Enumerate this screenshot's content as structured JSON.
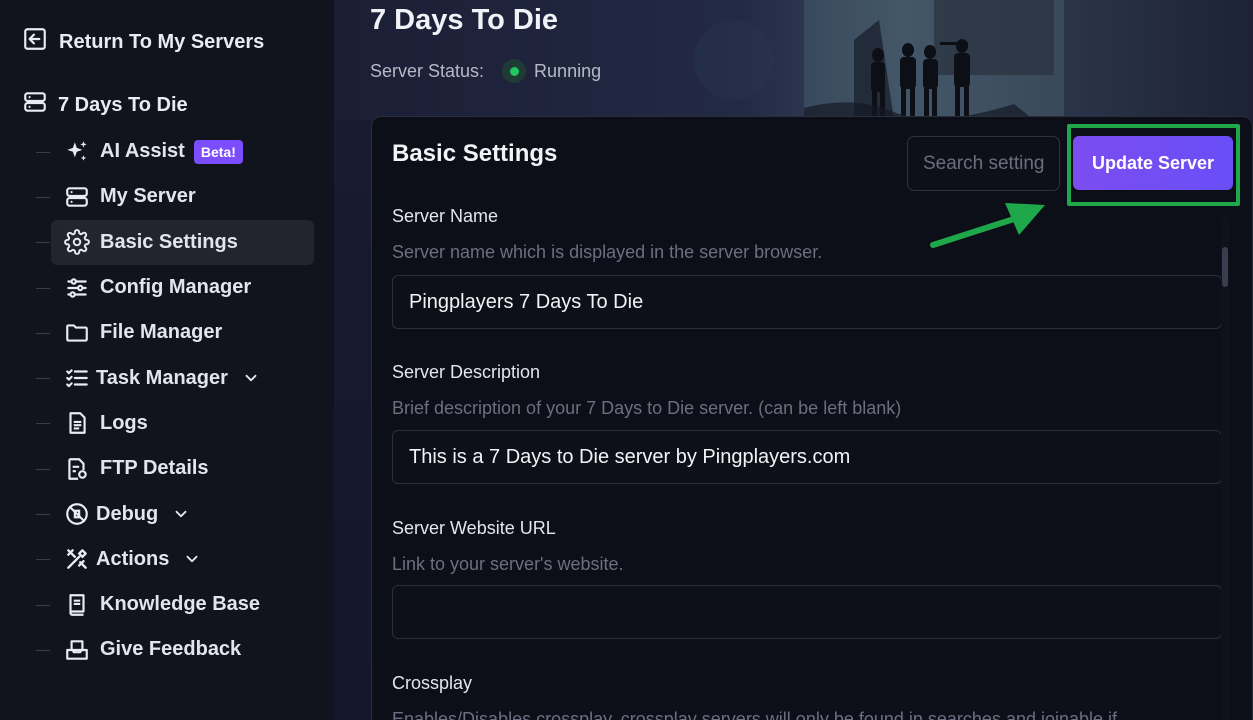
{
  "sidebar": {
    "return_label": "Return To My Servers",
    "server_name": "7 Days To Die",
    "items": [
      {
        "label": "AI Assist",
        "icon": "sparkles-icon",
        "badge": "Beta!"
      },
      {
        "label": "My Server",
        "icon": "server-icon"
      },
      {
        "label": "Basic Settings",
        "icon": "gear-icon",
        "active": true
      },
      {
        "label": "Config Manager",
        "icon": "sliders-icon"
      },
      {
        "label": "File Manager",
        "icon": "folder-icon"
      },
      {
        "label": "Task Manager",
        "icon": "task-list-icon",
        "expandable": true
      },
      {
        "label": "Logs",
        "icon": "document-icon"
      },
      {
        "label": "FTP Details",
        "icon": "file-details-icon"
      },
      {
        "label": "Debug",
        "icon": "bug-icon",
        "expandable": true
      },
      {
        "label": "Actions",
        "icon": "tools-icon",
        "expandable": true
      },
      {
        "label": "Knowledge Base",
        "icon": "book-icon"
      },
      {
        "label": "Give Feedback",
        "icon": "inbox-icon"
      }
    ]
  },
  "header": {
    "title": "7 Days To Die",
    "status_label": "Server Status:",
    "status_value": "Running",
    "status_color": "#22c55e"
  },
  "settings": {
    "title": "Basic Settings",
    "search_placeholder": "Search settings",
    "update_button": "Update Server",
    "accent_color": "#7b4df0",
    "fields": [
      {
        "label": "Server Name",
        "description": "Server name which is displayed in the server browser.",
        "value": "Pingplayers 7 Days To Die"
      },
      {
        "label": "Server Description",
        "description": "Brief description of your 7 Days to Die server. (can be left blank)",
        "value": "This is a 7 Days to Die server by Pingplayers.com"
      },
      {
        "label": "Server Website URL",
        "description": "Link to your server's website.",
        "value": ""
      },
      {
        "label": "Crossplay",
        "description": "Enables/Disables crossplay, crossplay servers will only be found in searches and joinable if"
      }
    ]
  },
  "annotation": {
    "highlight_color": "#1fa84a"
  }
}
